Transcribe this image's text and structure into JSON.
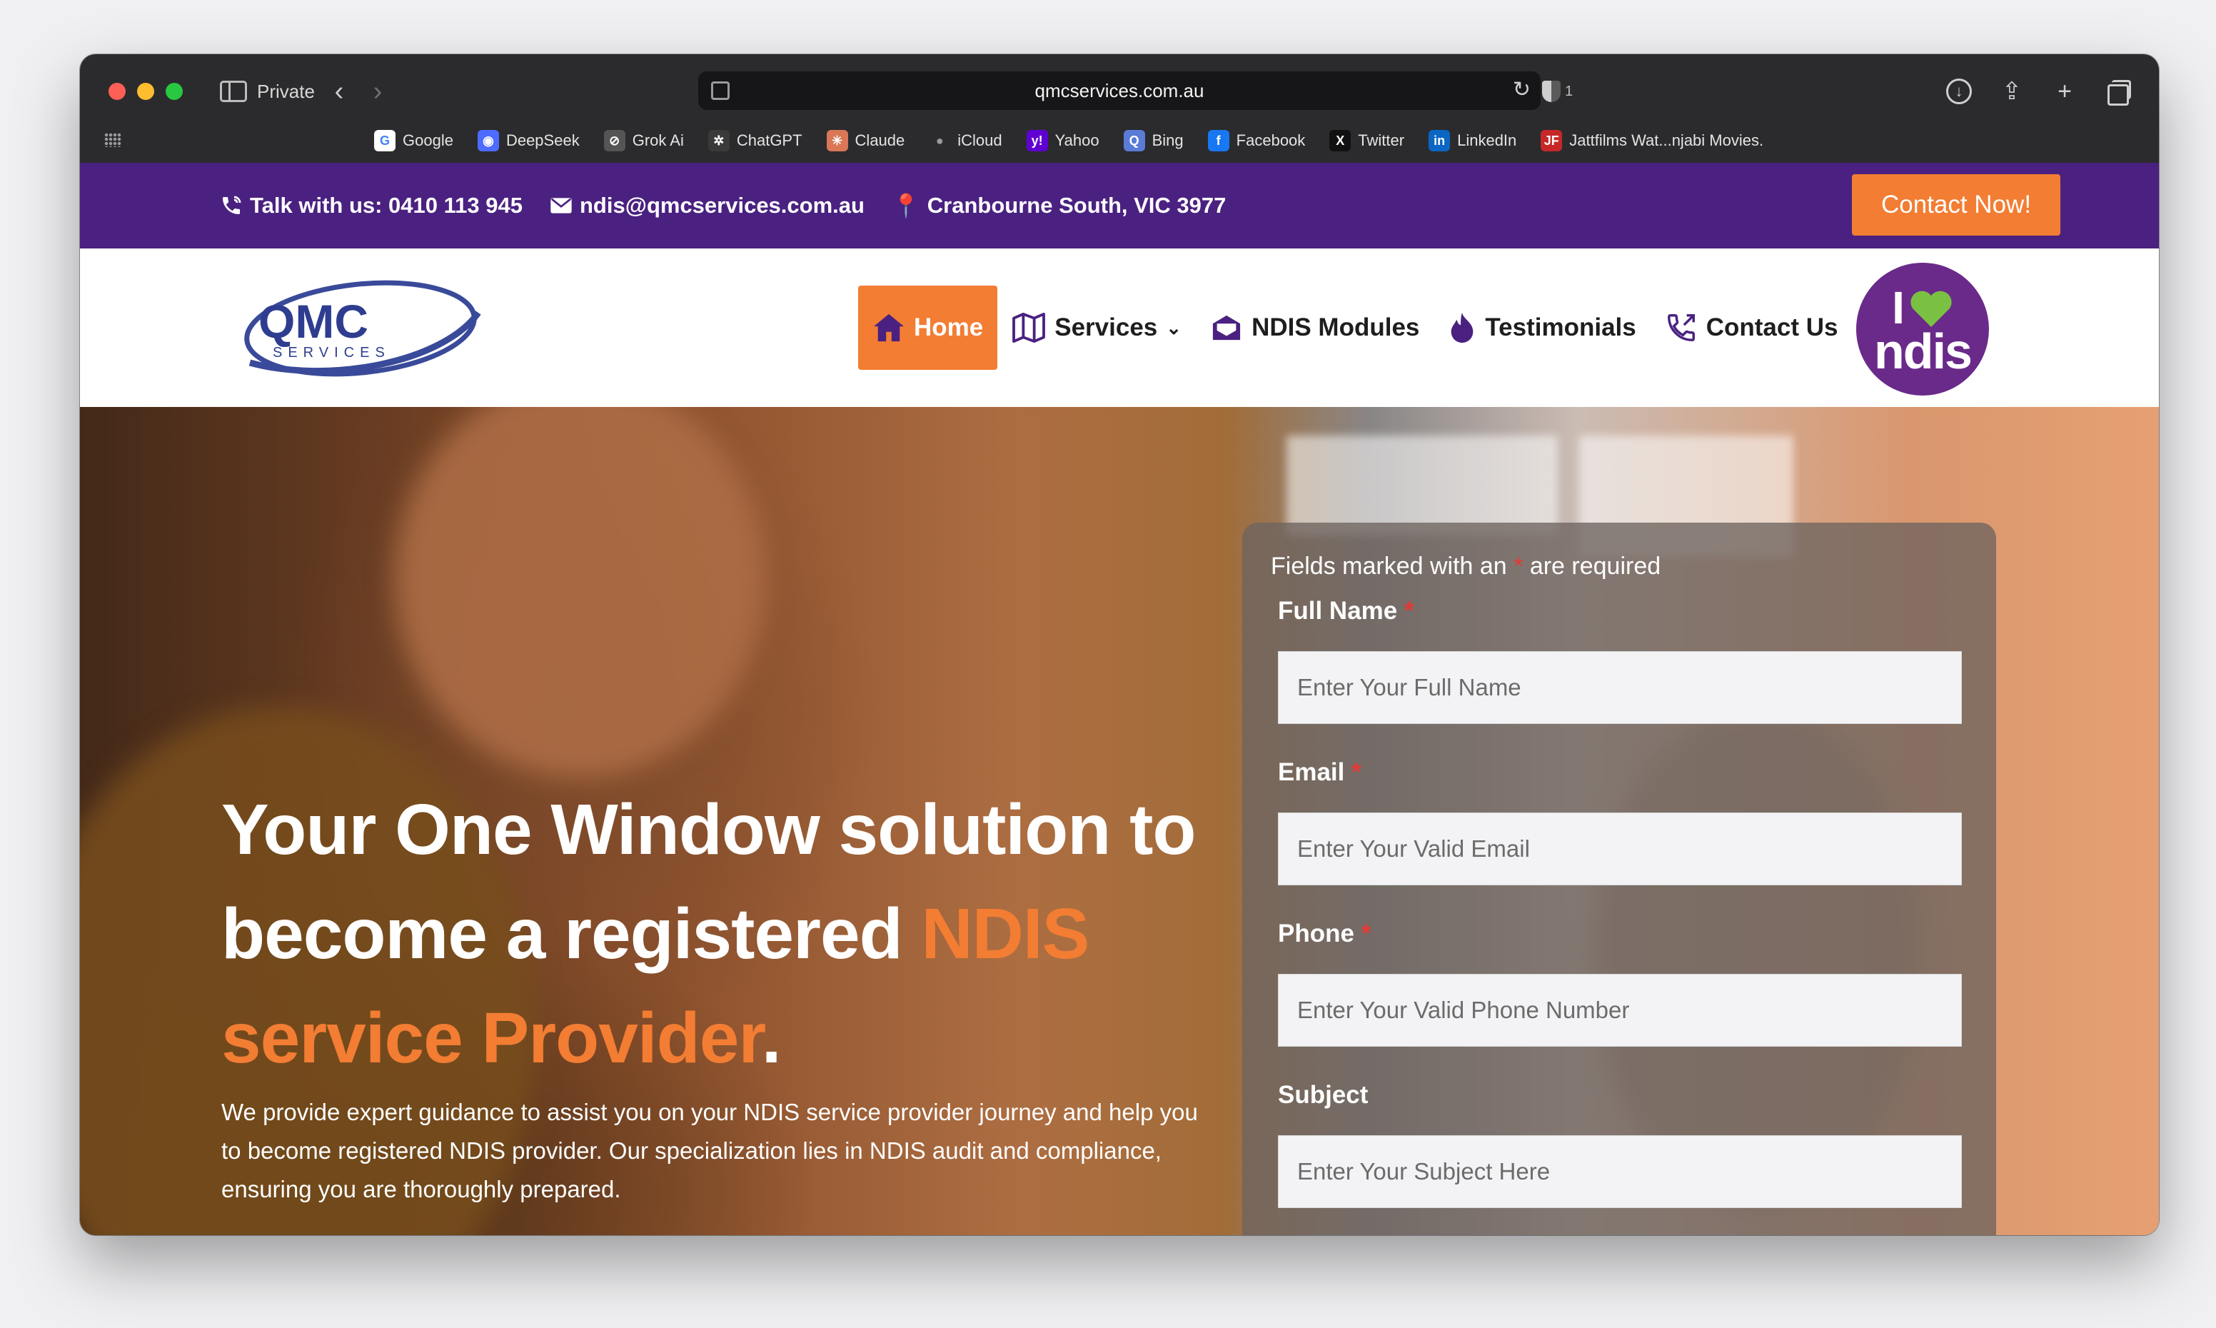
{
  "browser": {
    "mode_label": "Private",
    "url": "qmcservices.com.au",
    "shield_count": "1",
    "bookmarks": [
      {
        "label": "Google",
        "icon": "google-icon",
        "color": "#ffffff",
        "glyph": "G",
        "text_color": "#4285f4"
      },
      {
        "label": "DeepSeek",
        "icon": "deepseek-icon",
        "color": "#4d6bfe",
        "glyph": "◉"
      },
      {
        "label": "Grok Ai",
        "icon": "grok-icon",
        "color": "#555555",
        "glyph": "⊘"
      },
      {
        "label": "ChatGPT",
        "icon": "chatgpt-icon",
        "color": "#3a3a3a",
        "glyph": "✲"
      },
      {
        "label": "Claude",
        "icon": "claude-icon",
        "color": "#d97757",
        "glyph": "✳"
      },
      {
        "label": "iCloud",
        "icon": "apple-icon",
        "color": "#2b2b2d",
        "glyph": "●",
        "text_color": "#9a9a9a"
      },
      {
        "label": "Yahoo",
        "icon": "yahoo-icon",
        "color": "#6001d2",
        "glyph": "y!"
      },
      {
        "label": "Bing",
        "icon": "bing-icon",
        "color": "#5a7bd6",
        "glyph": "Q"
      },
      {
        "label": "Facebook",
        "icon": "facebook-icon",
        "color": "#1877f2",
        "glyph": "f"
      },
      {
        "label": "Twitter",
        "icon": "x-icon",
        "color": "#111111",
        "glyph": "X"
      },
      {
        "label": "LinkedIn",
        "icon": "linkedin-icon",
        "color": "#0a66c2",
        "glyph": "in"
      },
      {
        "label": "Jattfilms Wat...njabi Movies.",
        "icon": "jattfilms-icon",
        "color": "#c62828",
        "glyph": "JF"
      }
    ]
  },
  "topbar": {
    "phone": "Talk with us: 0410 113 945",
    "email": "ndis@qmcservices.com.au",
    "location": "Cranbourne South, VIC 3977",
    "cta_label": "Contact Now!"
  },
  "header": {
    "logo_text": "QMC",
    "logo_subtext": "SERVICES",
    "nav": [
      {
        "label": "Home",
        "icon": "home-icon",
        "active": true
      },
      {
        "label": "Services",
        "icon": "map-icon",
        "dropdown": true
      },
      {
        "label": "NDIS Modules",
        "icon": "envelope-open-icon"
      },
      {
        "label": "Testimonials",
        "icon": "flame-icon"
      },
      {
        "label": "Contact Us",
        "icon": "phone-outgoing-icon"
      }
    ],
    "badge_line1": "I",
    "badge_line2": "ndis"
  },
  "hero": {
    "headline_part1": "Your One Window solution to become a registered ",
    "headline_accent": "NDIS service Provider",
    "headline_end": ".",
    "subtext": "We provide expert guidance to assist you on your NDIS service provider journey and help you to become registered NDIS provider. Our specialization lies in NDIS audit and compliance, ensuring you are thoroughly prepared."
  },
  "form": {
    "note_prefix": "Fields marked with an ",
    "note_star": "*",
    "note_suffix": " are required",
    "fields": [
      {
        "label": "Full Name",
        "required": true,
        "placeholder": "Enter Your Full Name"
      },
      {
        "label": "Email",
        "required": true,
        "placeholder": "Enter Your Valid Email"
      },
      {
        "label": "Phone",
        "required": true,
        "placeholder": "Enter Your Valid Phone Number"
      },
      {
        "label": "Subject",
        "required": false,
        "placeholder": "Enter Your Subject Here"
      }
    ]
  },
  "colors": {
    "brand_purple": "#4a2180",
    "accent_orange": "#f27d33",
    "ndis_purple": "#6a2a8a",
    "ndis_green": "#7ac143"
  }
}
